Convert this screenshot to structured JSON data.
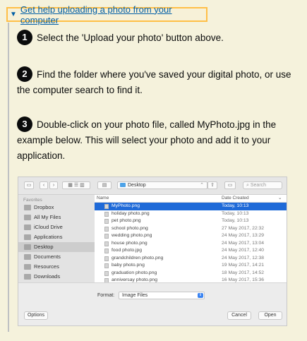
{
  "details": {
    "arrow": "▼",
    "summary_link": "Get help uploading a photo from your computer"
  },
  "steps": [
    {
      "number": "1",
      "text": "Select the 'Upload your photo' button above."
    },
    {
      "number": "2",
      "text": "Find the folder where you've saved your digital photo, or use the computer search to find it."
    },
    {
      "number": "3",
      "text": "Double-click on your photo file, called MyPhoto.jpg in the example below. This will select your photo and add it to your application."
    }
  ],
  "dialog": {
    "folder": "Desktop",
    "search_placeholder": "Search",
    "sidebar_header": "Favorites",
    "sidebar": [
      "Dropbox",
      "All My Files",
      "iCloud Drive",
      "Applications",
      "Desktop",
      "Documents",
      "Resources",
      "Downloads"
    ],
    "selected_sidebar": "Desktop",
    "columns": {
      "name": "Name",
      "date": "Date Created"
    },
    "files": [
      {
        "name": "MyPhoto.png",
        "date": "Today, 10:13",
        "selected": true
      },
      {
        "name": "holiday photo.png",
        "date": "Today, 10:13"
      },
      {
        "name": "pet photo.png",
        "date": "Today, 10:13"
      },
      {
        "name": "school photo.png",
        "date": "27 May 2017, 22:32"
      },
      {
        "name": "wedding photo.png",
        "date": "24 May 2017, 13:29"
      },
      {
        "name": "house photo.png",
        "date": "24 May 2017, 13:04"
      },
      {
        "name": "food photo.jpg",
        "date": "24 May 2017, 12:40"
      },
      {
        "name": "grandchildren photo.png",
        "date": "24 May 2017, 12:38"
      },
      {
        "name": "baby photo.png",
        "date": "19 May 2017, 14:21"
      },
      {
        "name": "graduation photo.png",
        "date": "18 May 2017, 14:52"
      },
      {
        "name": "anniversay photo.png",
        "date": "16 May 2017, 15:36"
      }
    ],
    "format_label": "Format:",
    "format_value": "Image Files",
    "options_button": "Options",
    "cancel_button": "Cancel",
    "open_button": "Open",
    "selection_color": "#1f6ad8"
  },
  "colors": {
    "link": "#005ea5",
    "focus": "#ffbf47",
    "background": "#f5f2dc"
  }
}
